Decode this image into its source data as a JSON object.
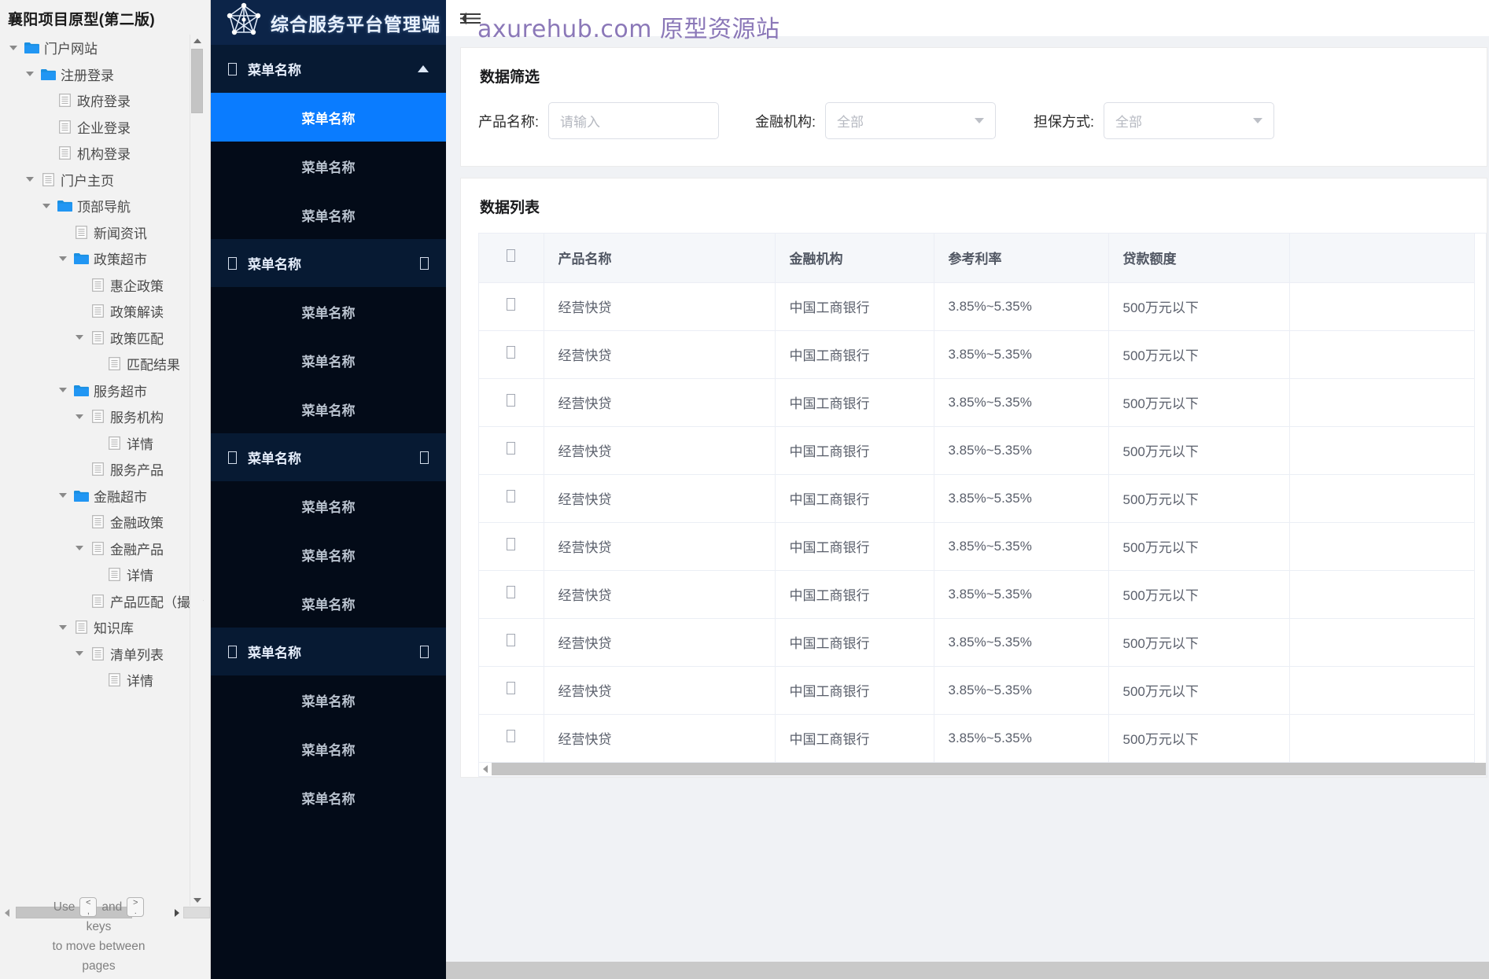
{
  "sitemap": {
    "title": "襄阳项目原型(第二版)",
    "nodes": [
      {
        "label": "门户网站",
        "depth": 0,
        "icon": "folder-icon",
        "caret": true
      },
      {
        "label": "注册登录",
        "depth": 1,
        "icon": "folder-icon",
        "caret": true
      },
      {
        "label": "政府登录",
        "depth": 2,
        "icon": "page-icon",
        "caret": false
      },
      {
        "label": "企业登录",
        "depth": 2,
        "icon": "page-icon",
        "caret": false
      },
      {
        "label": "机构登录",
        "depth": 2,
        "icon": "page-icon",
        "caret": false
      },
      {
        "label": "门户主页",
        "depth": 1,
        "icon": "page-icon",
        "caret": true
      },
      {
        "label": "顶部导航",
        "depth": 2,
        "icon": "folder-icon",
        "caret": true
      },
      {
        "label": "新闻资讯",
        "depth": 3,
        "icon": "page-icon",
        "caret": false
      },
      {
        "label": "政策超市",
        "depth": 3,
        "icon": "folder-icon",
        "caret": true
      },
      {
        "label": "惠企政策",
        "depth": 4,
        "icon": "page-icon",
        "caret": false
      },
      {
        "label": "政策解读",
        "depth": 4,
        "icon": "page-icon",
        "caret": false
      },
      {
        "label": "政策匹配",
        "depth": 4,
        "icon": "page-icon",
        "caret": true
      },
      {
        "label": "匹配结果",
        "depth": 5,
        "icon": "page-icon",
        "caret": false
      },
      {
        "label": "服务超市",
        "depth": 3,
        "icon": "folder-icon",
        "caret": true
      },
      {
        "label": "服务机构",
        "depth": 4,
        "icon": "page-icon",
        "caret": true
      },
      {
        "label": "详情",
        "depth": 5,
        "icon": "page-icon",
        "caret": false
      },
      {
        "label": "服务产品",
        "depth": 4,
        "icon": "page-icon",
        "caret": false
      },
      {
        "label": "金融超市",
        "depth": 3,
        "icon": "folder-icon",
        "caret": true
      },
      {
        "label": "金融政策",
        "depth": 4,
        "icon": "page-icon",
        "caret": false
      },
      {
        "label": "金融产品",
        "depth": 4,
        "icon": "page-icon",
        "caret": true
      },
      {
        "label": "详情",
        "depth": 5,
        "icon": "page-icon",
        "caret": false
      },
      {
        "label": "产品匹配（撮合",
        "depth": 4,
        "icon": "page-icon",
        "caret": false
      },
      {
        "label": "知识库",
        "depth": 3,
        "icon": "page-icon",
        "caret": true
      },
      {
        "label": "清单列表",
        "depth": 4,
        "icon": "page-icon",
        "caret": true
      },
      {
        "label": "详情",
        "depth": 5,
        "icon": "page-icon",
        "caret": false
      }
    ],
    "hint": {
      "use": "Use",
      "and": "and",
      "key_prev_top": "<",
      "key_prev_bottom": ",",
      "key_next_top": ">",
      "key_next_bottom": ".",
      "line2": "keys",
      "line3": "to move between",
      "line4": "pages"
    }
  },
  "darknav": {
    "brand_title": "综合服务平台管理端",
    "entries": [
      {
        "type": "group",
        "label": "菜单名称",
        "expanded": true
      },
      {
        "type": "item",
        "label": "菜单名称",
        "active": true
      },
      {
        "type": "item",
        "label": "菜单名称",
        "active": false
      },
      {
        "type": "item",
        "label": "菜单名称",
        "active": false
      },
      {
        "type": "group",
        "label": "菜单名称",
        "expanded": false
      },
      {
        "type": "item",
        "label": "菜单名称",
        "active": false
      },
      {
        "type": "item",
        "label": "菜单名称",
        "active": false
      },
      {
        "type": "item",
        "label": "菜单名称",
        "active": false
      },
      {
        "type": "group",
        "label": "菜单名称",
        "expanded": false
      },
      {
        "type": "item",
        "label": "菜单名称",
        "active": false
      },
      {
        "type": "item",
        "label": "菜单名称",
        "active": false
      },
      {
        "type": "item",
        "label": "菜单名称",
        "active": false
      },
      {
        "type": "group",
        "label": "菜单名称",
        "expanded": false
      },
      {
        "type": "item",
        "label": "菜单名称",
        "active": false
      },
      {
        "type": "item",
        "label": "菜单名称",
        "active": false
      },
      {
        "type": "item",
        "label": "菜单名称",
        "active": false
      }
    ]
  },
  "main": {
    "watermark": "axurehub.com 原型资源站",
    "filter": {
      "title": "数据筛选",
      "fields": [
        {
          "label": "产品名称:",
          "control": "text",
          "value": "",
          "placeholder": "请输入"
        },
        {
          "label": "金融机构:",
          "control": "select",
          "value": "全部"
        },
        {
          "label": "担保方式:",
          "control": "select",
          "value": "全部"
        }
      ]
    },
    "list": {
      "title": "数据列表",
      "columns": [
        "",
        "产品名称",
        "金融机构",
        "参考利率",
        "贷款额度"
      ],
      "rows": [
        [
          "",
          "经营快贷",
          "中国工商银行",
          "3.85%~5.35%",
          "500万元以下"
        ],
        [
          "",
          "经营快贷",
          "中国工商银行",
          "3.85%~5.35%",
          "500万元以下"
        ],
        [
          "",
          "经营快贷",
          "中国工商银行",
          "3.85%~5.35%",
          "500万元以下"
        ],
        [
          "",
          "经营快贷",
          "中国工商银行",
          "3.85%~5.35%",
          "500万元以下"
        ],
        [
          "",
          "经营快贷",
          "中国工商银行",
          "3.85%~5.35%",
          "500万元以下"
        ],
        [
          "",
          "经营快贷",
          "中国工商银行",
          "3.85%~5.35%",
          "500万元以下"
        ],
        [
          "",
          "经营快贷",
          "中国工商银行",
          "3.85%~5.35%",
          "500万元以下"
        ],
        [
          "",
          "经营快贷",
          "中国工商银行",
          "3.85%~5.35%",
          "500万元以下"
        ],
        [
          "",
          "经营快贷",
          "中国工商银行",
          "3.85%~5.35%",
          "500万元以下"
        ],
        [
          "",
          "经营快贷",
          "中国工商银行",
          "3.85%~5.35%",
          "500万元以下"
        ]
      ]
    }
  },
  "colors": {
    "accent_blue": "#0a7cff",
    "dark_bg": "#030b18",
    "brand_bg": "#0c2448",
    "watermark": "#8b78b8",
    "page_bg": "#f0f2f5"
  }
}
